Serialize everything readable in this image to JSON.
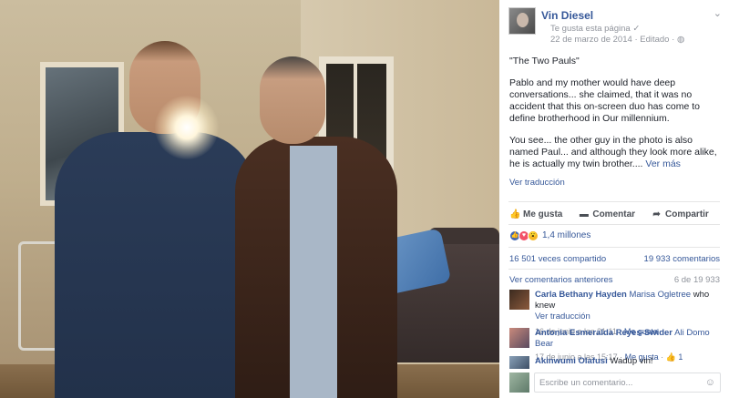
{
  "post": {
    "page_name": "Vin Diesel",
    "liked_label": "Te gusta esta página",
    "liked_check": "✓",
    "date": "22 de marzo de 2014",
    "edited": "Editado",
    "separator": "·",
    "privacy_icon": "globe-icon",
    "privacy_glyph": "◍",
    "menu_icon": "chevron-down-icon",
    "menu_glyph": "⌄",
    "paragraphs": [
      "\"The Two Pauls\"",
      "Pablo and my mother would have deep conversations... she claimed, that it was no accident that this on-screen duo has come to define brotherhood in Our millennium."
    ],
    "last_paragraph": "You see... the other guy in the photo is also named Paul... and although they look more alike, he is actually my twin brother....",
    "see_more": "Ver más",
    "translate": "Ver traducción"
  },
  "actions": {
    "like": "Me gusta",
    "like_glyph": "👍",
    "comment": "Comentar",
    "comment_glyph": "▬",
    "share": "Compartir",
    "share_glyph": "➦"
  },
  "reactions": {
    "count": "1,4 millones",
    "like_glyph": "👍",
    "love_glyph": "♥",
    "wow_glyph": "😮"
  },
  "stats": {
    "shares": "16 501 veces compartido",
    "comments": "19 933 comentarios"
  },
  "comments_header": {
    "previous": "Ver comentarios anteriores",
    "range": "6 de 19 933"
  },
  "comments": [
    {
      "name": "Carla Bethany Hayden",
      "tag": "Marisa Ogletree",
      "text": "who knew",
      "translate": "Ver traducción",
      "time": "16 de junio a las 21:11",
      "like": "Me gusta"
    },
    {
      "name": "Antonia Esmeralda Reyes-Swider",
      "tag": "Ali Domo Bear",
      "text": "",
      "time": "17 de junio a las 15:17",
      "like": "Me gusta",
      "likes_count": "1",
      "likes_glyph": "👍"
    },
    {
      "name": "Akinwumi Olafusi",
      "text": "Wadup vin!"
    }
  ],
  "composer": {
    "placeholder": "Escribe un comentario...",
    "emoji_glyph": "☺"
  },
  "colors": {
    "link": "#365899",
    "muted": "#90949c",
    "like_blue": "#4267b2",
    "love_red": "#f25268",
    "wow_yellow": "#f7b928"
  }
}
